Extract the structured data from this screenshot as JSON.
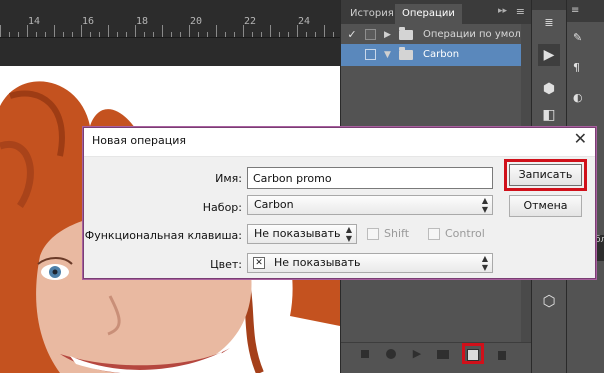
{
  "ruler": {
    "labels": [
      "14",
      "16",
      "18",
      "20",
      "22",
      "24"
    ]
  },
  "panel": {
    "tabs": [
      "История",
      "Операции"
    ],
    "collapse_glyph": "▸▸",
    "menu_glyph": "≡",
    "rows": [
      {
        "check": "✓",
        "toggle": "▶",
        "label": "Операции по умол..."
      },
      {
        "check": "",
        "toggle": "▼",
        "label": "Carbon"
      }
    ]
  },
  "far_panel": {
    "tab": "≡",
    "mini": "бл"
  },
  "dialog": {
    "title": "Новая операция",
    "close": "✕",
    "fields": {
      "name_label": "Имя:",
      "name_value": "Carbon promo",
      "set_label": "Набор:",
      "set_value": "Carbon",
      "fkey_label": "Функциональная клавиша:",
      "fkey_value": "Не показывать",
      "shift_label": "Shift",
      "control_label": "Control",
      "color_label": "Цвет:",
      "color_value": "Не показывать"
    },
    "buttons": {
      "record": "Записать",
      "cancel": "Отмена"
    },
    "highlight_color": "#d0101a"
  },
  "colors": {
    "selected_row": "#5a88bc",
    "panel_bg": "#535353",
    "annotation_red": "#d0101a"
  }
}
